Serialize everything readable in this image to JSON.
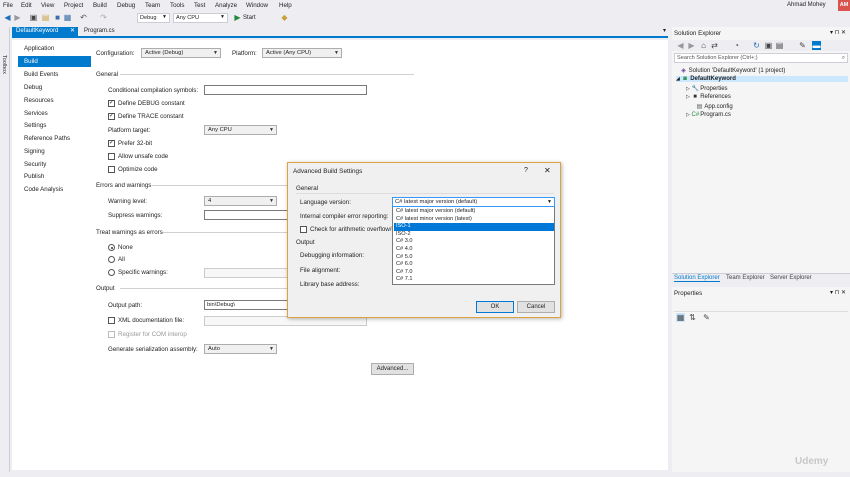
{
  "menu": [
    "File",
    "Edit",
    "View",
    "Project",
    "Build",
    "Debug",
    "Team",
    "Tools",
    "Test",
    "Analyze",
    "Window",
    "Help"
  ],
  "user": {
    "name": "Ahmad Mohey",
    "initials": "AM"
  },
  "toolbar": {
    "config": "Debug",
    "platform": "Any CPU",
    "start_label": "Start"
  },
  "toolbox_label": "Toolbox",
  "doc_tabs": [
    {
      "label": "DefaultKeyword",
      "active": true
    },
    {
      "label": "Program.cs",
      "active": false
    }
  ],
  "nav": [
    "Application",
    "Build",
    "Build Events",
    "Debug",
    "Resources",
    "Services",
    "Settings",
    "Reference Paths",
    "Signing",
    "Security",
    "Publish",
    "Code Analysis"
  ],
  "nav_active": "Build",
  "build": {
    "configuration_label": "Configuration:",
    "configuration_value": "Active (Debug)",
    "platform_label": "Platform:",
    "platform_value": "Active (Any CPU)",
    "general_header": "General",
    "cond_symbols_label": "Conditional compilation symbols:",
    "define_debug": "Define DEBUG constant",
    "define_trace": "Define TRACE constant",
    "platform_target_label": "Platform target:",
    "platform_target_value": "Any CPU",
    "prefer32": "Prefer 32-bit",
    "allow_unsafe": "Allow unsafe code",
    "optimize": "Optimize code",
    "errors_header": "Errors and warnings",
    "warning_level_label": "Warning level:",
    "warning_level_value": "4",
    "suppress_label": "Suppress warnings:",
    "treat_header": "Treat warnings as errors",
    "none": "None",
    "all": "All",
    "specific": "Specific warnings:",
    "output_header": "Output",
    "output_path_label": "Output path:",
    "output_path_value": "bin\\Debug\\",
    "xml_doc": "XML documentation file:",
    "register_com": "Register for COM interop",
    "gen_ser_label": "Generate serialization assembly:",
    "gen_ser_value": "Auto",
    "advanced_button": "Advanced..."
  },
  "dialog": {
    "title": "Advanced Build Settings",
    "help": "?",
    "close": "✕",
    "general": "General",
    "lang_label": "Language version:",
    "lang_value": "C# latest major version (default)",
    "ice_label": "Internal compiler error reporting:",
    "overflow_label": "Check for arithmetic overflow/u",
    "output": "Output",
    "debug_info_label": "Debugging information:",
    "file_align_label": "File alignment:",
    "base_addr_label": "Library base address:",
    "ok": "OK",
    "cancel": "Cancel",
    "options": [
      "C# latest major version (default)",
      "C# latest minor version (latest)",
      "ISO-1",
      "ISO-2",
      "C# 3.0",
      "C# 4.0",
      "C# 5.0",
      "C# 6.0",
      "C# 7.0",
      "C# 7.1"
    ],
    "selected_index": 2
  },
  "solution": {
    "title": "Solution Explorer",
    "search_placeholder": "Search Solution Explorer (Ctrl+;)",
    "tree": [
      "Solution 'DefaultKeyword' (1 project)",
      "DefaultKeyword",
      "Properties",
      "References",
      "App.config",
      "Program.cs"
    ],
    "tabs": [
      "Solution Explorer",
      "Team Explorer",
      "Server Explorer"
    ]
  },
  "properties": {
    "title": "Properties"
  },
  "watermark": "Udemy"
}
